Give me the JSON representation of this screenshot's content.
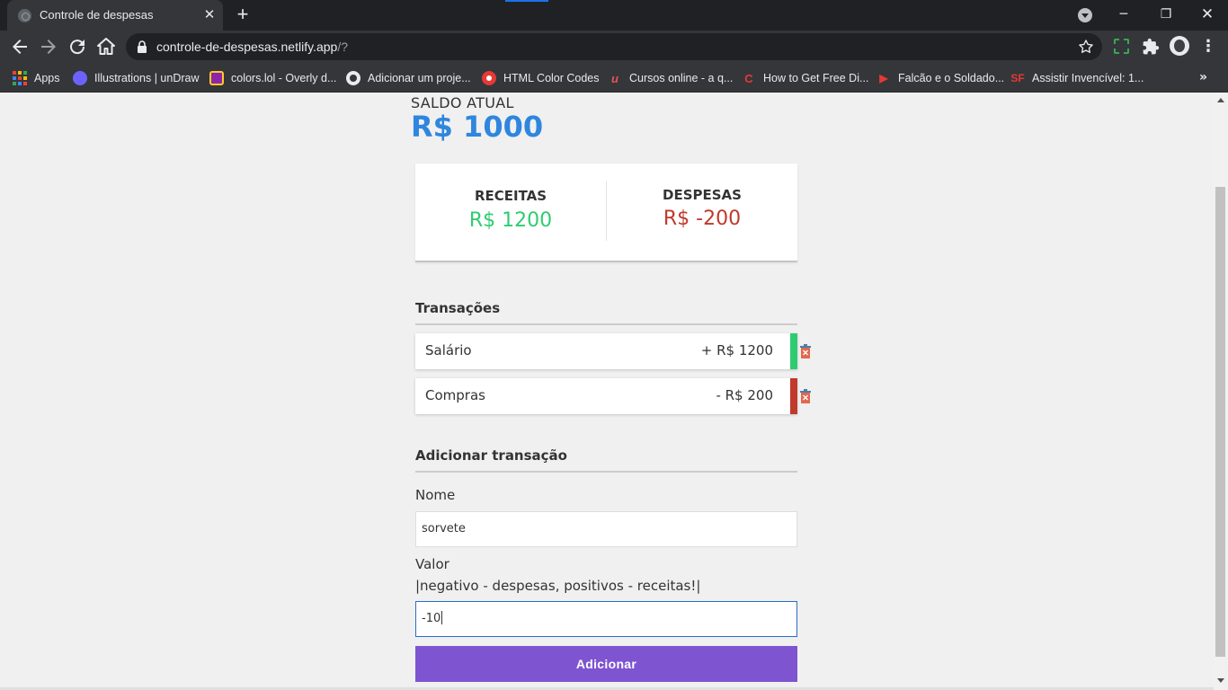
{
  "browser": {
    "tab_title": "Controle de despesas",
    "url_host": "controle-de-despesas.netlify.app",
    "url_path": "/?",
    "bookmarks": [
      {
        "label": "Apps",
        "icon": "apps-grid-icon"
      },
      {
        "label": "Illustrations | unDraw",
        "icon": "undraw-icon"
      },
      {
        "label": "colors.lol - Overly d...",
        "icon": "colors-lol-icon"
      },
      {
        "label": "Adicionar um proje...",
        "icon": "github-icon"
      },
      {
        "label": "HTML Color Codes",
        "icon": "html-color-codes-icon"
      },
      {
        "label": "Cursos online - a q...",
        "icon": "udemy-icon"
      },
      {
        "label": "How to Get Free Di...",
        "icon": "c-icon"
      },
      {
        "label": "Falcão e o Soldado...",
        "icon": "play-icon"
      },
      {
        "label": "Assistir Invencível: 1...",
        "icon": "sf-icon"
      }
    ]
  },
  "balance": {
    "label": "SALDO ATUAL",
    "value": "R$ 1000"
  },
  "summary": {
    "income_title": "RECEITAS",
    "income_value": "R$ 1200",
    "expense_title": "DESPESAS",
    "expense_value": "R$ -200"
  },
  "transactions": {
    "title": "Transações",
    "items": [
      {
        "name": "Salário",
        "amount": "+ R$ 1200",
        "type": "income"
      },
      {
        "name": "Compras",
        "amount": "- R$ 200",
        "type": "expense"
      }
    ]
  },
  "form": {
    "title": "Adicionar transação",
    "name_label": "Nome",
    "name_value": "sorvete",
    "value_label": "Valor",
    "value_hint": "|negativo - despesas, positivos - receitas!|",
    "value_value": "-10",
    "submit_label": "Adicionar"
  },
  "colors": {
    "balance": "#2e86de",
    "income": "#2ecc71",
    "expense": "#c0392b",
    "button": "#7e54d1"
  }
}
